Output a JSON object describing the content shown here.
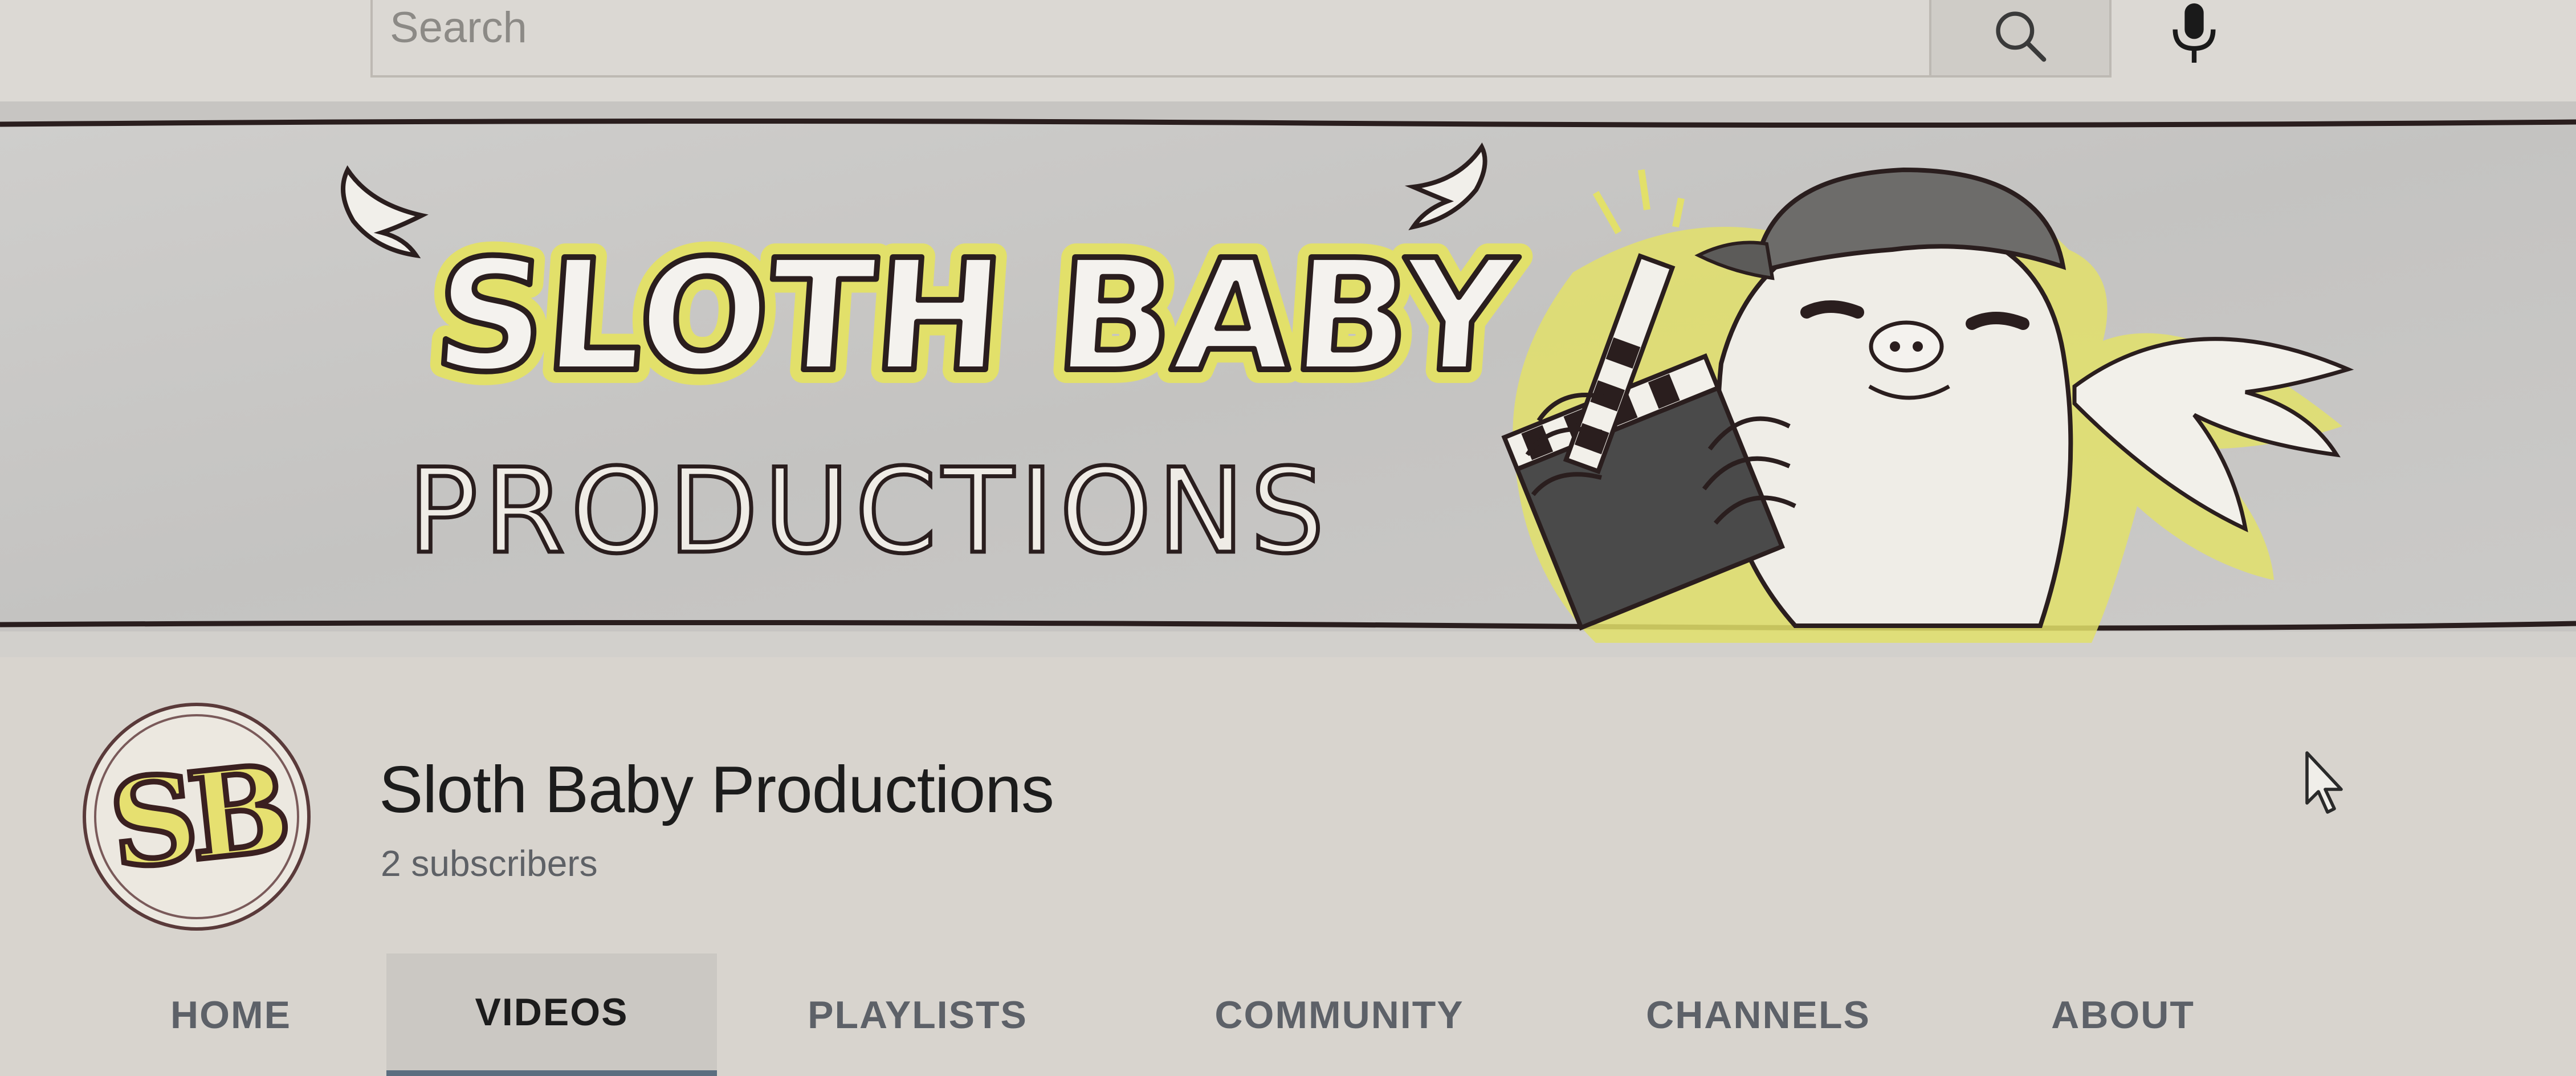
{
  "search": {
    "placeholder": "Search",
    "search_icon": "search-icon",
    "mic_icon": "microphone-icon"
  },
  "banner": {
    "title_line1": "SLOTH BABY",
    "title_line2": "PRODUCTIONS",
    "accent_color": "#e2e06a",
    "illustration": "sloth-with-clapperboard-and-cap"
  },
  "channel": {
    "avatar_initials": "SB",
    "name": "Sloth Baby Productions",
    "subscribers": "2 subscribers"
  },
  "tabs": [
    {
      "label": "HOME",
      "active": false
    },
    {
      "label": "VIDEOS",
      "active": true
    },
    {
      "label": "PLAYLISTS",
      "active": false
    },
    {
      "label": "COMMUNITY",
      "active": false
    },
    {
      "label": "CHANNELS",
      "active": false
    },
    {
      "label": "ABOUT",
      "active": false
    }
  ],
  "colors": {
    "background": "#d8d4ce",
    "active_tab_underline": "#5b6e80",
    "text_primary": "#1c1c1c",
    "text_secondary": "#5e6166"
  }
}
